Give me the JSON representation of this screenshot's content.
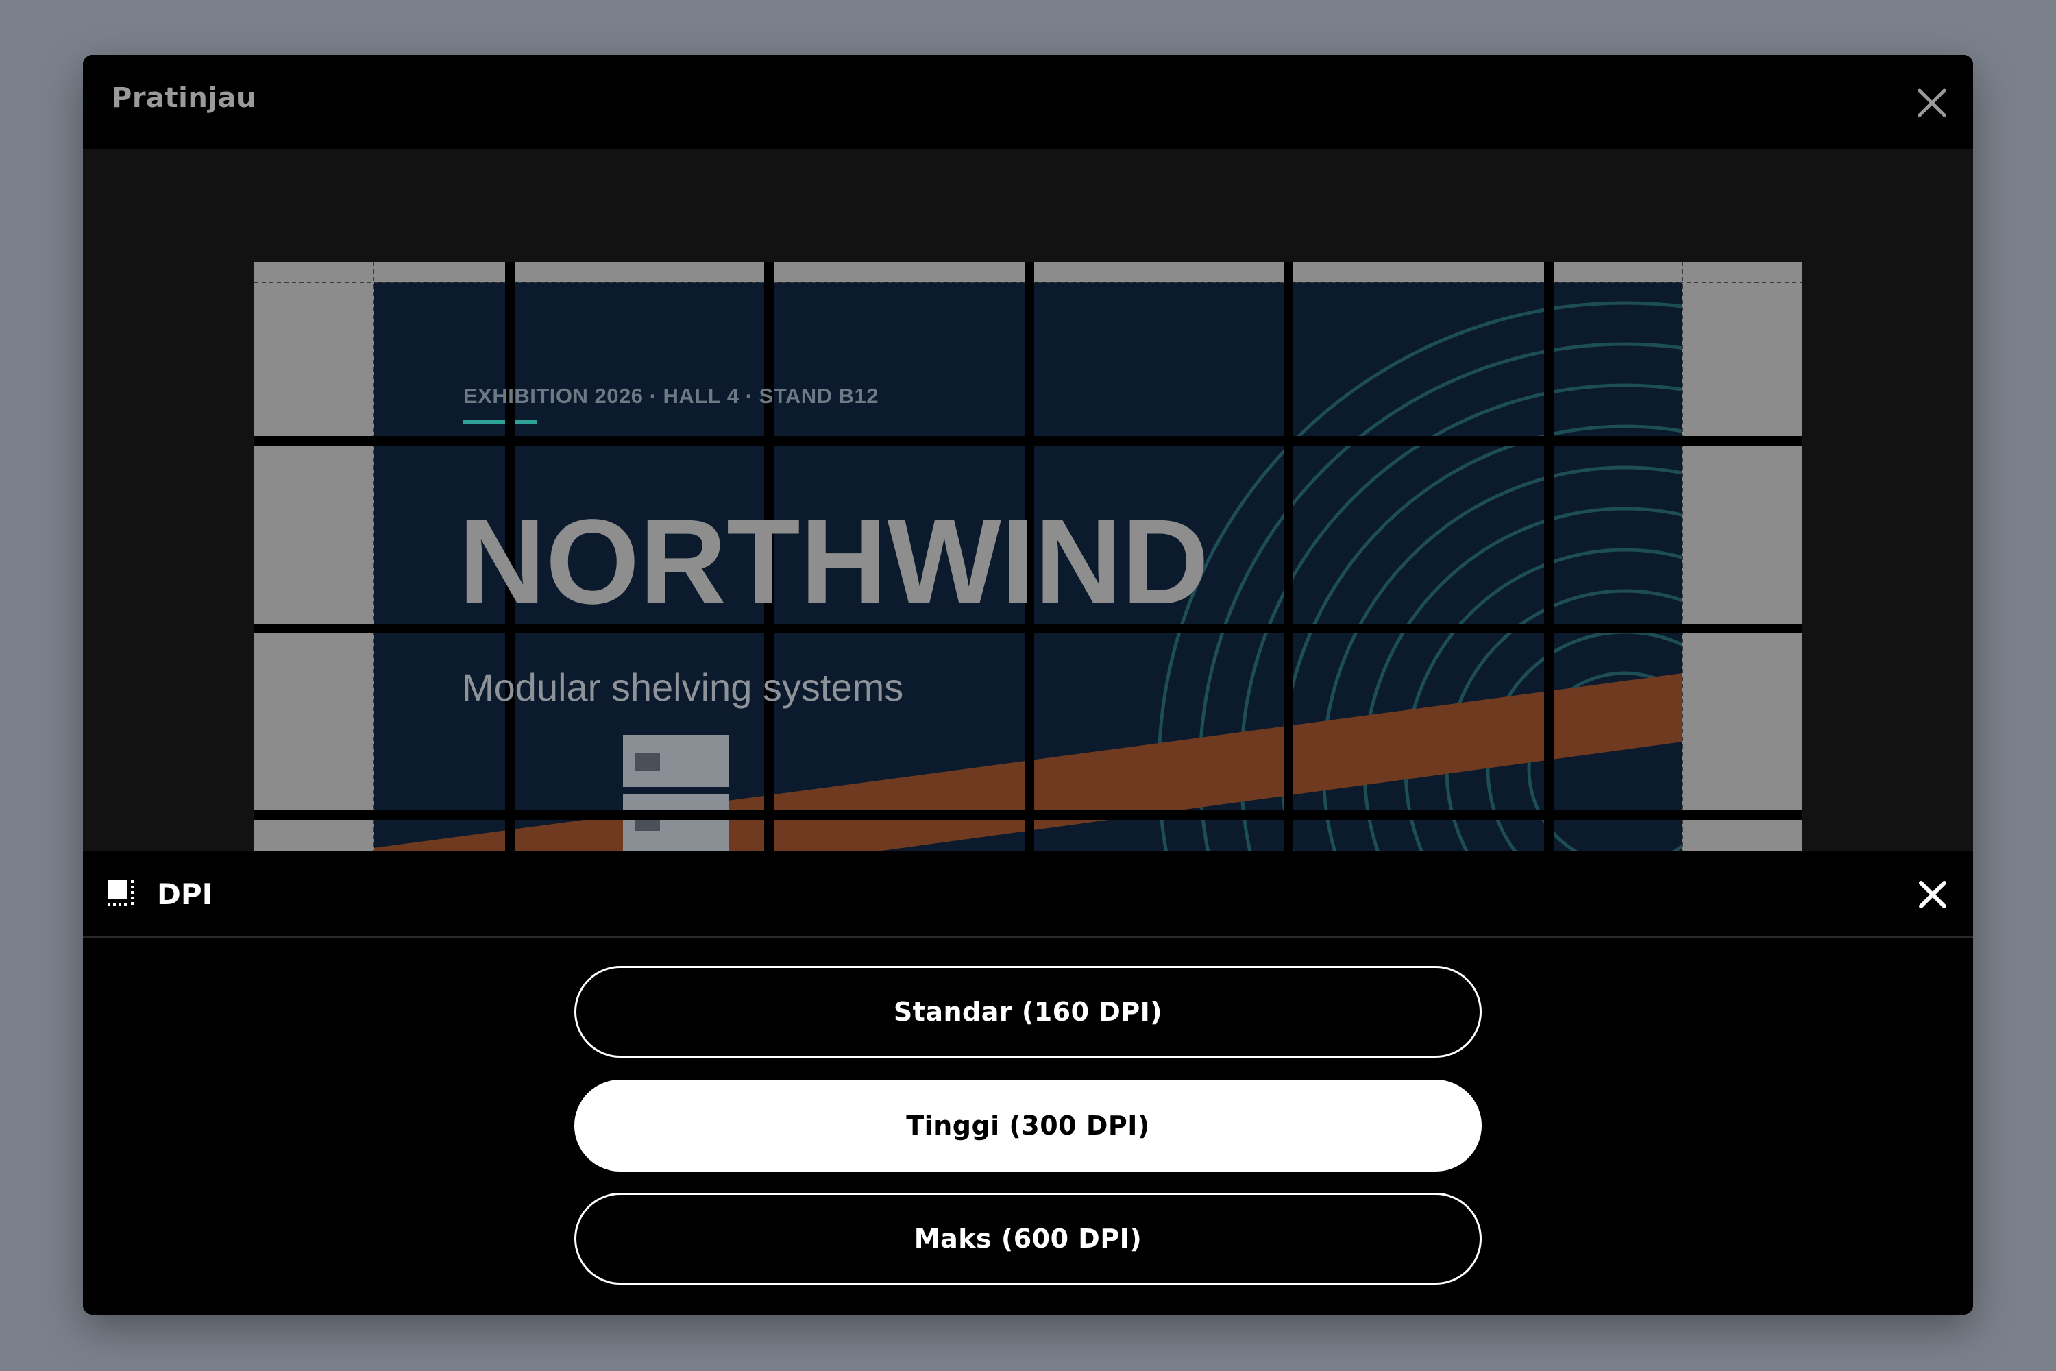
{
  "modal": {
    "title": "Pratinjau"
  },
  "preview": {
    "kicker": "EXHIBITION 2026 · HALL 4 · STAND B12",
    "headline": "NORTHWIND",
    "tagline": "Modular shelving systems",
    "colors": {
      "background": "#0b1a2c",
      "stripe": "#a0521f",
      "bleed": "#8c8c8c",
      "accent": "#2fa39a"
    }
  },
  "dpi_panel": {
    "title": "DPI",
    "options": [
      {
        "label": "Standar (160 DPI)",
        "selected": false
      },
      {
        "label": "Tinggi (300 DPI)",
        "selected": true
      },
      {
        "label": "Maks (600 DPI)",
        "selected": false
      }
    ]
  }
}
